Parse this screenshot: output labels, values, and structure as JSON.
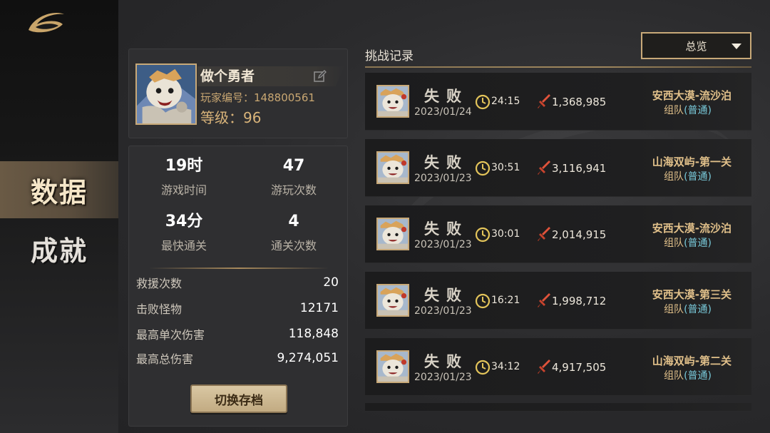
{
  "nav": {
    "items": [
      {
        "label": "数据",
        "active": true
      },
      {
        "label": "成就",
        "active": false
      }
    ]
  },
  "profile": {
    "name": "做个勇者",
    "player_id_label": "玩家编号：",
    "player_id": "148800561",
    "level_label": "等级：",
    "level": "96"
  },
  "stats": {
    "grid": [
      {
        "value": "19时",
        "label": "游戏时间"
      },
      {
        "value": "47",
        "label": "游玩次数"
      },
      {
        "value": "34分",
        "label": "最快通关"
      },
      {
        "value": "4",
        "label": "通关次数"
      }
    ],
    "rows": [
      {
        "label": "救援次数",
        "value": "20"
      },
      {
        "label": "击败怪物",
        "value": "12171"
      },
      {
        "label": "最高单次伤害",
        "value": "118,848"
      },
      {
        "label": "最高总伤害",
        "value": "9,274,051"
      }
    ],
    "switch_button": "切换存档"
  },
  "records": {
    "title": "挑战记录",
    "filter": {
      "selected": "总览"
    },
    "items": [
      {
        "result": "失败",
        "date": "2023/01/24",
        "time": "24:15",
        "damage": "1,368,985",
        "stage": "安西大漠-流沙泊",
        "mode": "组队",
        "difficulty": "(普通)"
      },
      {
        "result": "失败",
        "date": "2023/01/23",
        "time": "30:51",
        "damage": "3,116,941",
        "stage": "山海双屿-第一关",
        "mode": "组队",
        "difficulty": "(普通)"
      },
      {
        "result": "失败",
        "date": "2023/01/23",
        "time": "30:01",
        "damage": "2,014,915",
        "stage": "安西大漠-流沙泊",
        "mode": "组队",
        "difficulty": "(普通)"
      },
      {
        "result": "失败",
        "date": "2023/01/23",
        "time": "16:21",
        "damage": "1,998,712",
        "stage": "安西大漠-第三关",
        "mode": "组队",
        "difficulty": "(普通)"
      },
      {
        "result": "失败",
        "date": "2023/01/23",
        "time": "34:12",
        "damage": "4,917,505",
        "stage": "山海双屿-第二关",
        "mode": "组队",
        "difficulty": "(普通)"
      }
    ]
  },
  "colors": {
    "accent_gold": "#c8a978",
    "stage_text": "#e1c08a",
    "difficulty_text": "#78c8d8",
    "damage_icon": "#d0442c"
  },
  "icons": {
    "logo": "crescent-logo-icon",
    "edit": "edit-icon",
    "clock": "clock-icon",
    "damage": "sword-damage-icon",
    "filter_caret": "caret-down-icon"
  }
}
